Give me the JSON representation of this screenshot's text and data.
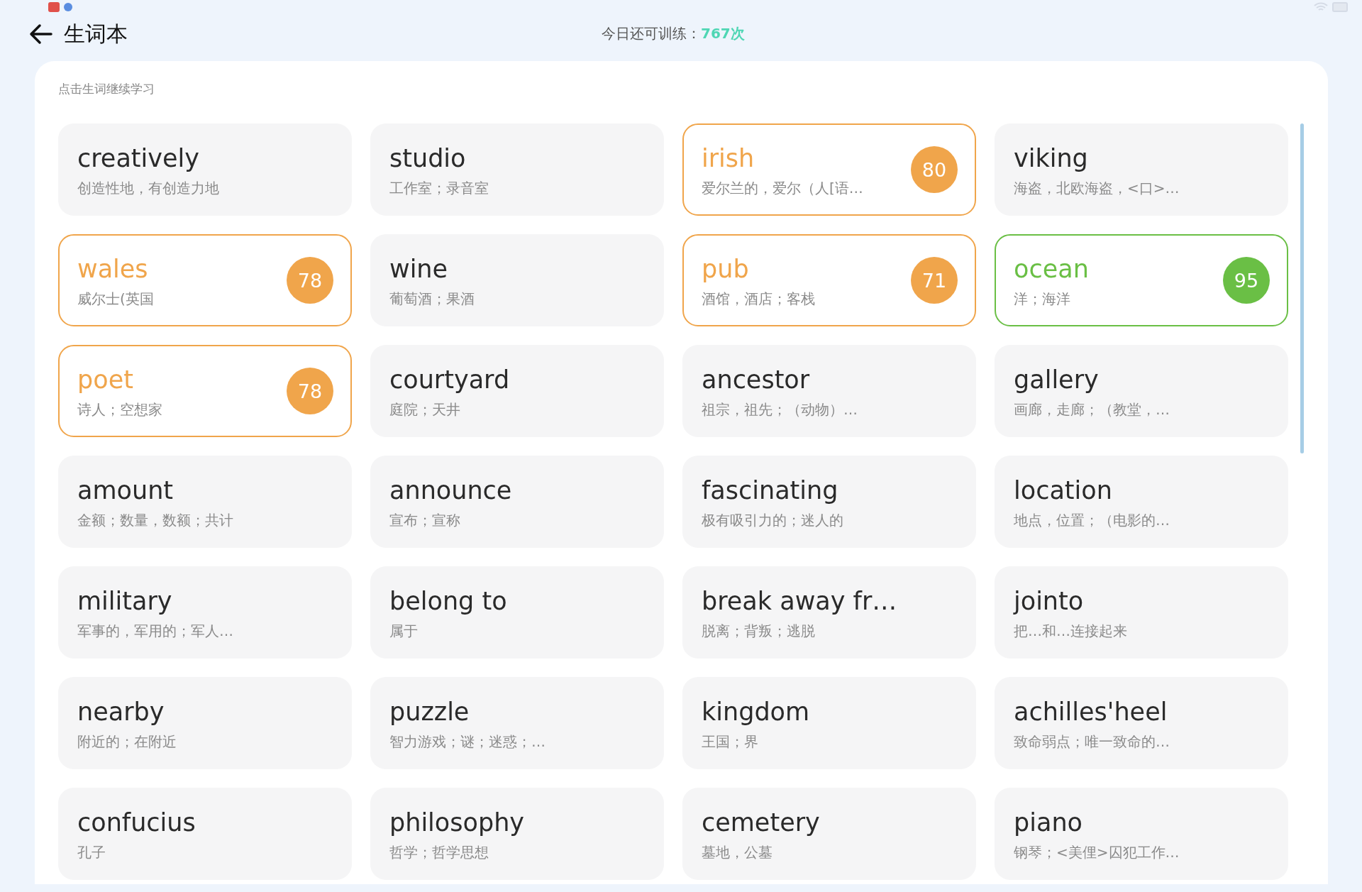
{
  "header": {
    "title": "生词本",
    "quota_label": "今日还可训练：",
    "quota_value": "767次"
  },
  "panel": {
    "hint": "点击生词继续学习",
    "words": [
      {
        "word": "creatively",
        "meaning": "创造性地，有创造力地"
      },
      {
        "word": "studio",
        "meaning": "工作室；录音室"
      },
      {
        "word": "irish",
        "meaning": "爱尔兰的，爱尔（人[语…",
        "score": "80",
        "color": "#f0a54b"
      },
      {
        "word": "viking",
        "meaning": "海盗，北欧海盗，<口>…"
      },
      {
        "word": "wales",
        "meaning": "威尔士(英国",
        "score": "78",
        "color": "#f0a54b"
      },
      {
        "word": "wine",
        "meaning": "葡萄酒；果酒"
      },
      {
        "word": "pub",
        "meaning": "酒馆，酒店；客栈",
        "score": "71",
        "color": "#f0a54b"
      },
      {
        "word": "ocean",
        "meaning": "洋；海洋",
        "score": "95",
        "color": "#6abf45"
      },
      {
        "word": "poet",
        "meaning": "诗人；空想家",
        "score": "78",
        "color": "#f0a54b"
      },
      {
        "word": "courtyard",
        "meaning": "庭院；天井"
      },
      {
        "word": "ancestor",
        "meaning": "祖宗，祖先；（动物）…"
      },
      {
        "word": "gallery",
        "meaning": "画廊，走廊；（教堂，…"
      },
      {
        "word": "amount",
        "meaning": "金额；数量，数额；共计"
      },
      {
        "word": "announce",
        "meaning": "宣布；宣称"
      },
      {
        "word": "fascinating",
        "meaning": "极有吸引力的；迷人的"
      },
      {
        "word": "location",
        "meaning": "地点，位置；（电影的…"
      },
      {
        "word": "military",
        "meaning": "军事的，军用的；军人…"
      },
      {
        "word": "belong to",
        "meaning": "属于"
      },
      {
        "word": "break away fr…",
        "meaning": "脱离；背叛；逃脱"
      },
      {
        "word": "jointo",
        "meaning": "把…和…连接起来"
      },
      {
        "word": "nearby",
        "meaning": "附近的；在附近"
      },
      {
        "word": "puzzle",
        "meaning": "智力游戏；谜；迷惑；…"
      },
      {
        "word": "kingdom",
        "meaning": "王国；界"
      },
      {
        "word": "achilles'heel",
        "meaning": "致命弱点；唯一致命的…"
      },
      {
        "word": "confucius",
        "meaning": "孔子"
      },
      {
        "word": "philosophy",
        "meaning": "哲学；哲学思想"
      },
      {
        "word": "cemetery",
        "meaning": "墓地，公墓"
      },
      {
        "word": "piano",
        "meaning": "钢琴；<美俚>囚犯工作…"
      }
    ]
  }
}
